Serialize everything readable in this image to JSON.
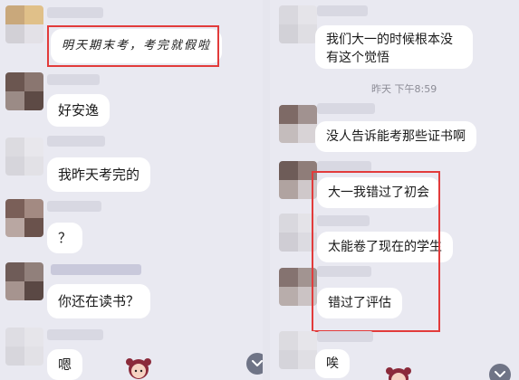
{
  "left_chat": {
    "messages": [
      {
        "text": "明天期末考，考完就假啦"
      },
      {
        "text": "好安逸"
      },
      {
        "text": "我昨天考完的"
      },
      {
        "text": "？"
      },
      {
        "text": "你还在读书？"
      },
      {
        "text": "嗯"
      }
    ]
  },
  "right_chat": {
    "messages": [
      {
        "text": "我们大一的时候根本没有这个觉悟"
      },
      {
        "text": "没人告诉能考那些证书啊"
      },
      {
        "text": "大一我错过了初会"
      },
      {
        "text": "太能卷了现在的学生"
      },
      {
        "text": "错过了评估"
      },
      {
        "text": "唉"
      }
    ],
    "timestamp": "昨天 下午8:59"
  },
  "icons": {
    "scroll_down": "chevron-down-icon",
    "mascot": "cartoon-girl-icon"
  },
  "colors": {
    "background": "#e9e9f1",
    "bubble": "#ffffff",
    "highlight": "#e23b3b",
    "fab": "#6f7486"
  }
}
